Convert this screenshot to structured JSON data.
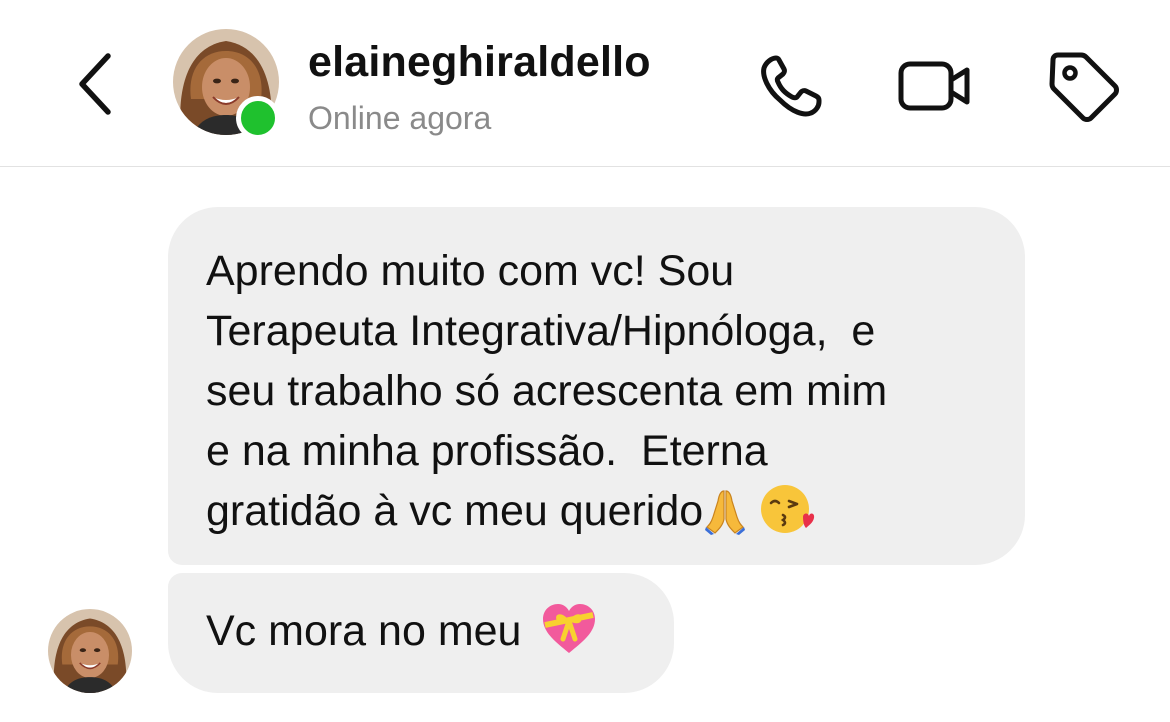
{
  "header": {
    "back_icon": "chevron-left-icon",
    "username": "elaineghiraldello",
    "status": "Online agora",
    "online_color": "#1fc12e",
    "actions": [
      {
        "icon": "phone-icon"
      },
      {
        "icon": "video-camera-icon"
      },
      {
        "icon": "tag-icon"
      }
    ]
  },
  "messages": [
    {
      "sender": "elaineghiraldello",
      "lines": [
        "Aprendo muito com vc! Sou",
        "Terapeuta Integrativa/Hipnóloga,  e",
        "seu trabalho só acrescenta em mim",
        "e na minha profissão.  Eterna",
        "gratidão à vc meu querido"
      ],
      "emojis": [
        "praying-hands-emoji",
        "face-blowing-kiss-emoji"
      ]
    },
    {
      "sender": "elaineghiraldello",
      "text": "Vc mora no meu",
      "emojis": [
        "heart-with-ribbon-emoji"
      ]
    }
  ],
  "colors": {
    "bubble_bg": "#efefef",
    "text": "#111111",
    "status_text": "#8a8a8a",
    "divider": "#e2e2e2"
  }
}
